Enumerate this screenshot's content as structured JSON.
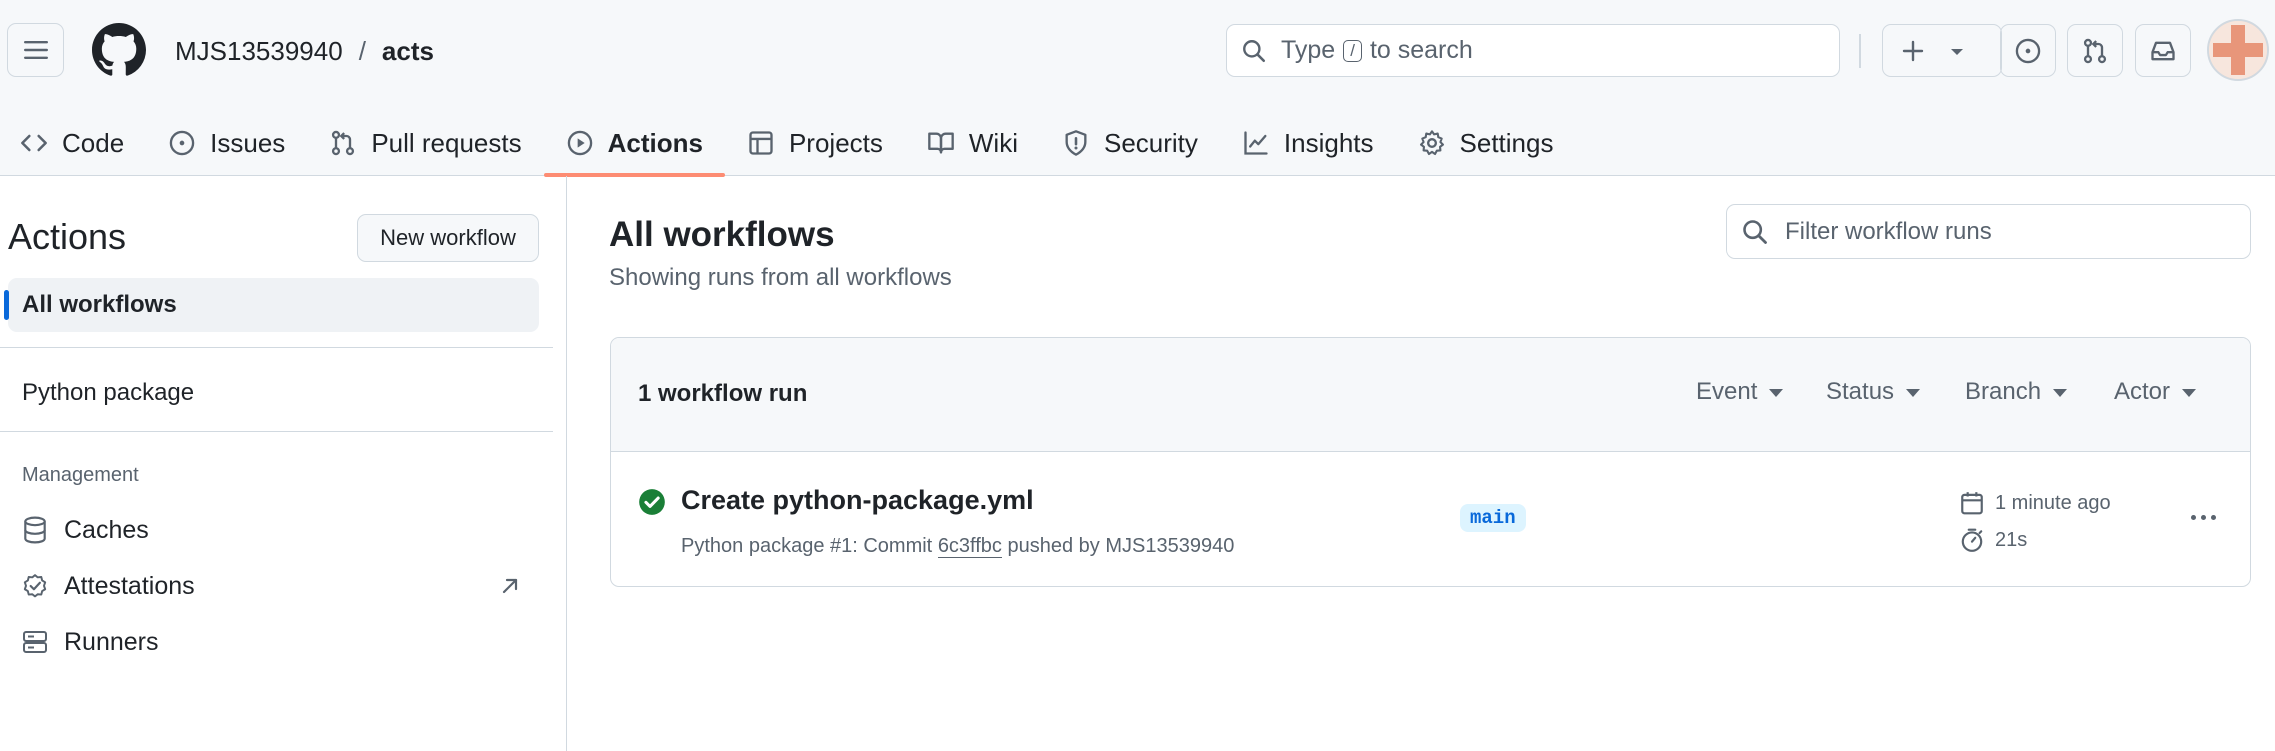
{
  "header": {
    "owner": "MJS13539940",
    "separator": "/",
    "repo": "acts",
    "search": {
      "prefix": "Type",
      "key": "/",
      "suffix": "to search"
    }
  },
  "tabs": [
    {
      "label": "Code",
      "icon": "code-icon"
    },
    {
      "label": "Issues",
      "icon": "issue-icon"
    },
    {
      "label": "Pull requests",
      "icon": "pull-request-icon"
    },
    {
      "label": "Actions",
      "icon": "play-icon",
      "active": true
    },
    {
      "label": "Projects",
      "icon": "table-icon"
    },
    {
      "label": "Wiki",
      "icon": "book-icon"
    },
    {
      "label": "Security",
      "icon": "shield-icon"
    },
    {
      "label": "Insights",
      "icon": "graph-icon"
    },
    {
      "label": "Settings",
      "icon": "gear-icon"
    }
  ],
  "sidebar": {
    "title": "Actions",
    "new_workflow": "New workflow",
    "all_workflows": "All workflows",
    "workflows": [
      "Python package"
    ],
    "management_label": "Management",
    "management": [
      {
        "label": "Caches",
        "icon": "database-icon"
      },
      {
        "label": "Attestations",
        "icon": "verified-icon"
      },
      {
        "label": "Runners",
        "icon": "server-icon"
      }
    ]
  },
  "main": {
    "title": "All workflows",
    "subtitle": "Showing runs from all workflows",
    "filter_placeholder": "Filter workflow runs",
    "run_count": "1 workflow run",
    "filters": [
      "Event",
      "Status",
      "Branch",
      "Actor"
    ],
    "runs": [
      {
        "title": "Create python-package.yml",
        "workflow": "Python package #1: Commit",
        "sha": "6c3ffbc",
        "pushed_by": "pushed by MJS13539940",
        "branch": "main",
        "when": "1 minute ago",
        "duration": "21s",
        "status": "success"
      }
    ]
  },
  "colors": {
    "accent": "#0969da",
    "tab_underline": "#fd8c73",
    "success": "#1a7f37",
    "muted": "#59636e"
  }
}
